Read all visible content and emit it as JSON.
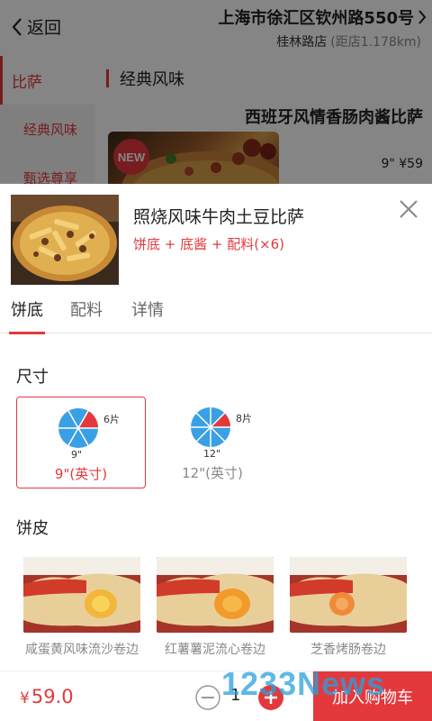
{
  "header": {
    "back_label": "返回",
    "address": "上海市徐汇区钦州路550号",
    "store_name": "桂林路店",
    "distance": "(距店1.178km)"
  },
  "sidebar": {
    "items": [
      {
        "label": "比萨"
      },
      {
        "label": "经典风味"
      },
      {
        "label": "甄选尊享"
      }
    ]
  },
  "background_list": {
    "section_title": "经典风味",
    "product_title": "西班牙风情香肠肉酱比萨",
    "new_badge": "NEW",
    "price_text": "9\" ¥59"
  },
  "product": {
    "name": "照烧风味牛肉土豆比萨",
    "subtitle": "饼底 + 底酱 + 配料(×6)"
  },
  "tabs": [
    {
      "label": "饼底"
    },
    {
      "label": "配料"
    },
    {
      "label": "详情"
    }
  ],
  "size_section": {
    "title": "尺寸",
    "options": [
      {
        "label": "9\"(英寸)",
        "slices": "6片",
        "inch": "9\"",
        "slice_count": 6,
        "selected": true
      },
      {
        "label": "12\"(英寸)",
        "slices": "8片",
        "inch": "12\"",
        "slice_count": 8,
        "selected": false
      }
    ]
  },
  "crust_section": {
    "title": "饼皮",
    "items": [
      {
        "name": "咸蛋黄风味流沙卷边",
        "fill_color": "#f2b63a"
      },
      {
        "name": "红薯薯泥流心卷边",
        "fill_color": "#f29a2a"
      },
      {
        "name": "芝香烤肠卷边",
        "fill_color": "#f08a3a"
      }
    ]
  },
  "bottom_bar": {
    "currency": "¥",
    "total": "59.0",
    "quantity": "1",
    "add_cart_label": "加入购物车"
  },
  "watermark": "1233News",
  "colors": {
    "accent": "#e4393c",
    "pie_blue": "#3aa0e6"
  }
}
